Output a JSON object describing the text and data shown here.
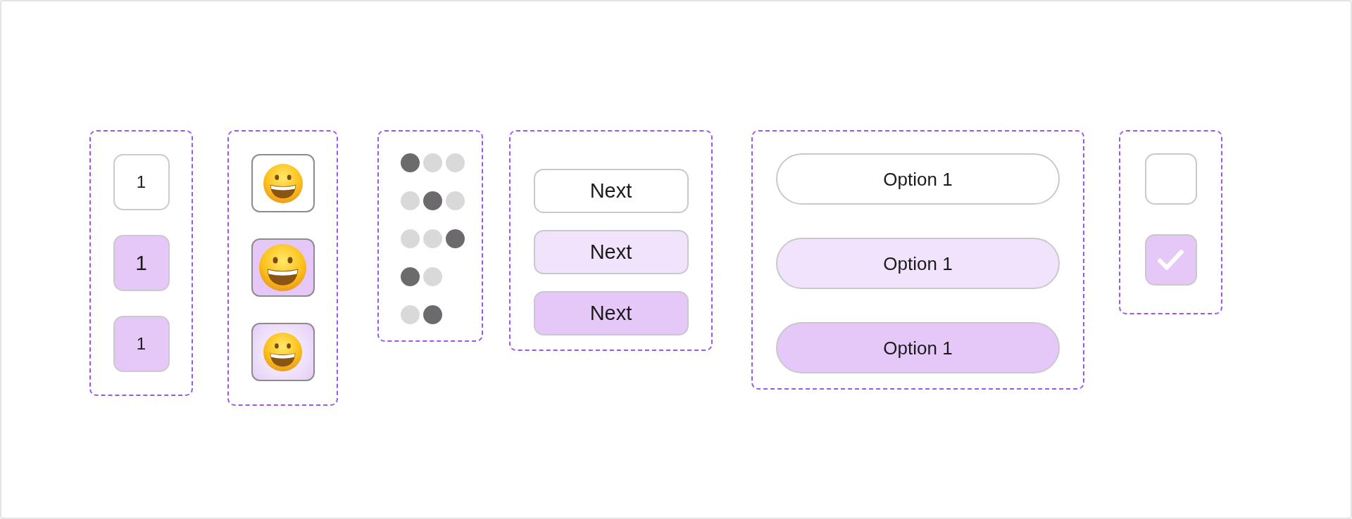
{
  "number_tiles": [
    {
      "label": "1",
      "kind": "default"
    },
    {
      "label": "1",
      "kind": "hover"
    },
    {
      "label": "1",
      "kind": "pressed"
    }
  ],
  "emoji_tiles": [
    {
      "kind": "default"
    },
    {
      "kind": "hover"
    },
    {
      "kind": "pressed"
    }
  ],
  "page_dots": [
    {
      "dots": [
        {
          "selected": true
        },
        {
          "selected": false
        },
        {
          "selected": false
        }
      ]
    },
    {
      "dots": [
        {
          "selected": false
        },
        {
          "selected": true
        },
        {
          "selected": false
        }
      ]
    },
    {
      "dots": [
        {
          "selected": false
        },
        {
          "selected": false
        },
        {
          "selected": true
        }
      ]
    },
    {
      "dots": [
        {
          "selected": true
        },
        {
          "selected": false
        }
      ]
    },
    {
      "dots": [
        {
          "selected": false
        },
        {
          "selected": true
        }
      ]
    }
  ],
  "next_buttons": [
    {
      "label": "Next",
      "kind": "default"
    },
    {
      "label": "Next",
      "kind": "hover"
    },
    {
      "label": "Next",
      "kind": "pressed"
    }
  ],
  "option_pills": [
    {
      "label": "Option 1",
      "kind": "default"
    },
    {
      "label": "Option 1",
      "kind": "hover"
    },
    {
      "label": "Option 1",
      "kind": "pressed"
    }
  ],
  "checkboxes": [
    {
      "checked": false
    },
    {
      "checked": true
    }
  ]
}
